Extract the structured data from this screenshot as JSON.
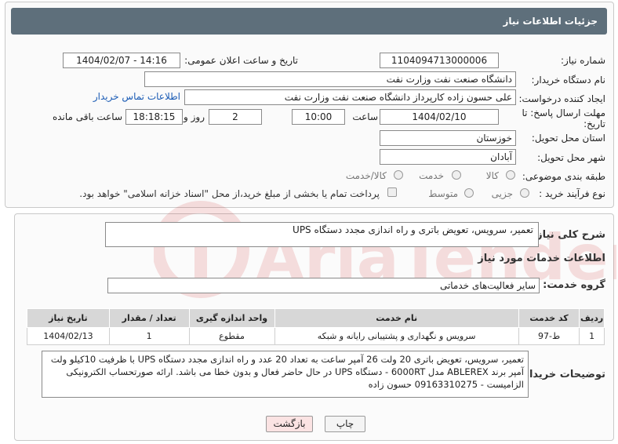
{
  "header": {
    "title": "جزئیات اطلاعات نیاز"
  },
  "form": {
    "need_number_label": "شماره نیاز:",
    "need_number": "1104094713000006",
    "announce_label": "تاریخ و ساعت اعلان عمومی:",
    "announce_value": "1404/02/07 - 14:16",
    "buyer_org_label": "نام دستگاه خریدار:",
    "buyer_org": "دانشگاه صنعت نفت وزارت نفت",
    "creator_label": "ایجاد کننده درخواست:",
    "creator": "علی حسون زاده کارپرداز دانشگاه صنعت نفت وزارت نفت",
    "contact_link": "اطلاعات تماس خریدار",
    "deadline_label_1": "مهلت ارسال پاسخ: تا",
    "deadline_label_2": "تاریخ:",
    "deadline_date": "1404/02/10",
    "time_label": "ساعت",
    "deadline_time": "10:00",
    "days_value": "2",
    "days_label": "روز و",
    "remaining_time": "18:18:15",
    "remaining_label": "ساعت باقی مانده",
    "province_label": "استان محل تحویل:",
    "province": "خوزستان",
    "city_label": "شهر محل تحویل:",
    "city": "آبادان",
    "category_label": "طبقه بندی موضوعی:",
    "category_options": [
      "کالا",
      "خدمت",
      "کالا/خدمت"
    ],
    "process_label": "نوع فرآیند خرید :",
    "process_options": [
      "جزیی",
      "متوسط"
    ],
    "payment_note": "پرداخت تمام یا بخشی از مبلغ خرید،از محل \"اسناد خزانه اسلامی\" خواهد بود."
  },
  "watermark": {
    "text": "AriaTender.neT"
  },
  "summary": {
    "label": "شرح کلی نیاز:",
    "value": "تعمیر، سرویس، تعویض باتری و راه اندازی مجدد دستگاه UPS"
  },
  "services": {
    "section_title": "اطلاعات خدمات مورد نیاز",
    "group_label": "گروه خدمت:",
    "group_value": "سایر فعالیت‌های خدماتی",
    "columns": [
      "ردیف",
      "کد خدمت",
      "نام خدمت",
      "واحد اندازه گیری",
      "تعداد / مقدار",
      "تاریخ نیاز"
    ],
    "rows": [
      [
        "1",
        "ط-97",
        "سرویس و نگهداری و پشتیبانی رایانه و شبکه",
        "مقطوع",
        "1",
        "1404/02/13"
      ]
    ]
  },
  "buyer_notes": {
    "label": "توضیحات خریدار:",
    "value": "تعمیر، سرویس، تعویض باتری 20 ولت 26 آمپر ساعت به تعداد 20 عدد و راه اندازی مجدد دستگاه UPS با ظرفیت 10کیلو ولت آمپر برند ABLEREX مدل 6000RT - دستگاه UPS در حال حاضر فعال و بدون خطا می باشد. ارائه صورتحساب الکترونیکی الزامیست - 09163310275 حسون زاده"
  },
  "buttons": {
    "print": "چاپ",
    "back": "بازگشت"
  },
  "colors": {
    "header_bg": "#5e6f7b",
    "link": "#1a5bb5",
    "back_btn": "#fbe3e3",
    "watermark": "#cc2a2a"
  }
}
